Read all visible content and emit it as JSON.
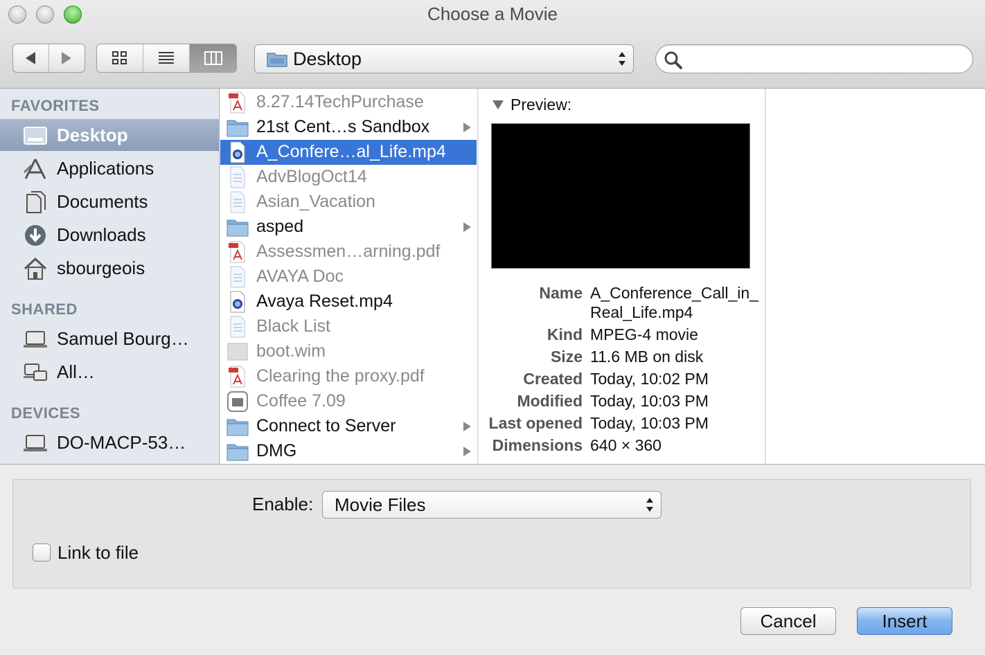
{
  "window": {
    "title": "Choose a Movie"
  },
  "toolbar": {
    "location": "Desktop",
    "search_value": "",
    "search_placeholder": ""
  },
  "sidebar": {
    "sections": [
      {
        "heading": "FAVORITES",
        "items": [
          "Desktop",
          "Applications",
          "Documents",
          "Downloads",
          "sbourgeois"
        ]
      },
      {
        "heading": "SHARED",
        "items": [
          "Samuel Bourg…",
          "All…"
        ]
      },
      {
        "heading": "DEVICES",
        "items": [
          "DO-MACP-53…"
        ]
      }
    ],
    "selected": "Desktop"
  },
  "files": [
    {
      "name": "8.27.14TechPurchase",
      "type": "pdf",
      "dim": true,
      "folder": false
    },
    {
      "name": "21st Cent…s Sandbox",
      "type": "folder",
      "dim": false,
      "folder": true
    },
    {
      "name": "A_Confere…al_Life.mp4",
      "type": "movie",
      "dim": false,
      "folder": false,
      "selected": true
    },
    {
      "name": "AdvBlogOct14",
      "type": "doc",
      "dim": true,
      "folder": false
    },
    {
      "name": "Asian_Vacation",
      "type": "doc",
      "dim": true,
      "folder": false
    },
    {
      "name": "asped",
      "type": "folder",
      "dim": false,
      "folder": true
    },
    {
      "name": "Assessmen…arning.pdf",
      "type": "pdf",
      "dim": true,
      "folder": false
    },
    {
      "name": "AVAYA Doc",
      "type": "doc",
      "dim": true,
      "folder": false
    },
    {
      "name": "Avaya Reset.mp4",
      "type": "movie",
      "dim": false,
      "folder": false
    },
    {
      "name": "Black List",
      "type": "doc",
      "dim": true,
      "folder": false
    },
    {
      "name": "boot.wim",
      "type": "blank",
      "dim": true,
      "folder": false
    },
    {
      "name": "Clearing the proxy.pdf",
      "type": "pdf",
      "dim": true,
      "folder": false
    },
    {
      "name": "Coffee 7.09",
      "type": "app",
      "dim": true,
      "folder": false
    },
    {
      "name": "Connect to Server",
      "type": "folder",
      "dim": false,
      "folder": true
    },
    {
      "name": "DMG",
      "type": "folder",
      "dim": false,
      "folder": true
    }
  ],
  "preview": {
    "heading": "Preview:",
    "meta": [
      {
        "key": "Name",
        "value": "A_Conference_Call_in_",
        "value2": "Real_Life.mp4"
      },
      {
        "key": "Kind",
        "value": "MPEG-4 movie"
      },
      {
        "key": "Size",
        "value": "11.6 MB on disk"
      },
      {
        "key": "Created",
        "value": "Today, 10:02 PM"
      },
      {
        "key": "Modified",
        "value": "Today, 10:03 PM"
      },
      {
        "key": "Last opened",
        "value": "Today, 10:03 PM"
      },
      {
        "key": "Dimensions",
        "value": "640 × 360"
      }
    ]
  },
  "accessory": {
    "enable_label": "Enable:",
    "enable_value": "Movie Files",
    "link_label": "Link to file",
    "link_checked": false
  },
  "buttons": {
    "cancel": "Cancel",
    "insert": "Insert"
  },
  "colors": {
    "selection": "#3875d7",
    "default_button": "#84b4ee",
    "sidebar_bg": "#e3e8ee"
  },
  "icons": {
    "back": "back-arrow-icon",
    "forward": "forward-arrow-icon",
    "views": [
      "icon-view-icon",
      "list-view-icon",
      "column-view-icon"
    ],
    "search": "search-icon"
  }
}
